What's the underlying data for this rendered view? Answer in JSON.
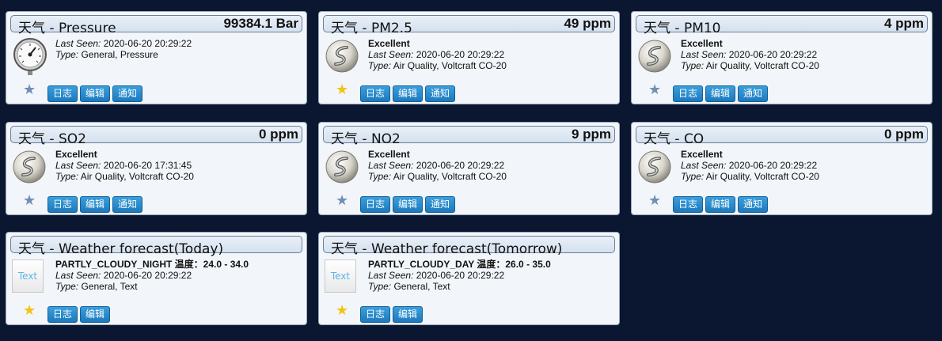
{
  "buttons": {
    "log": "日志",
    "edit": "编辑",
    "notify": "通知"
  },
  "cards": [
    {
      "title": "天气 - Pressure",
      "value": "99384.1 Bar",
      "status": "",
      "last_seen_label": "Last Seen:",
      "last_seen": "2020-06-20 20:29:22",
      "type_label": "Type:",
      "type": "General, Pressure",
      "icon": "pressure-gauge-icon",
      "favorite": false
    },
    {
      "title": "天气 - PM2.5",
      "value": "49 ppm",
      "status": "Excellent",
      "last_seen_label": "Last Seen:",
      "last_seen": "2020-06-20 20:29:22",
      "type_label": "Type:",
      "type": "Air Quality, Voltcraft CO-20",
      "icon": "air-quality-icon",
      "favorite": true
    },
    {
      "title": "天气 - PM10",
      "value": "4 ppm",
      "status": "Excellent",
      "last_seen_label": "Last Seen:",
      "last_seen": "2020-06-20 20:29:22",
      "type_label": "Type:",
      "type": "Air Quality, Voltcraft CO-20",
      "icon": "air-quality-icon",
      "favorite": false
    },
    {
      "title": "天气 - SO2",
      "value": "0 ppm",
      "status": "Excellent",
      "last_seen_label": "Last Seen:",
      "last_seen": "2020-06-20 17:31:45",
      "type_label": "Type:",
      "type": "Air Quality, Voltcraft CO-20",
      "icon": "air-quality-icon",
      "favorite": false
    },
    {
      "title": "天气 - NO2",
      "value": "9 ppm",
      "status": "Excellent",
      "last_seen_label": "Last Seen:",
      "last_seen": "2020-06-20 20:29:22",
      "type_label": "Type:",
      "type": "Air Quality, Voltcraft CO-20",
      "icon": "air-quality-icon",
      "favorite": false
    },
    {
      "title": "天气 - CO",
      "value": "0 ppm",
      "status": "Excellent",
      "last_seen_label": "Last Seen:",
      "last_seen": "2020-06-20 20:29:22",
      "type_label": "Type:",
      "type": "Air Quality, Voltcraft CO-20",
      "icon": "air-quality-icon",
      "favorite": false
    },
    {
      "title": "天气 - Weather forecast(Today)",
      "value": "",
      "status": "PARTLY_CLOUDY_NIGHT 温度：24.0 - 34.0",
      "last_seen_label": "Last Seen:",
      "last_seen": "2020-06-20 20:29:22",
      "type_label": "Type:",
      "type": "General, Text",
      "icon": "text-icon",
      "icon_text": "Text",
      "favorite": true
    },
    {
      "title": "天气 - Weather forecast(Tomorrow)",
      "value": "",
      "status": "PARTLY_CLOUDY_DAY 温度：26.0 - 35.0",
      "last_seen_label": "Last Seen:",
      "last_seen": "2020-06-20 20:29:22",
      "type_label": "Type:",
      "type": "General, Text",
      "icon": "text-icon",
      "icon_text": "Text",
      "favorite": true
    }
  ]
}
